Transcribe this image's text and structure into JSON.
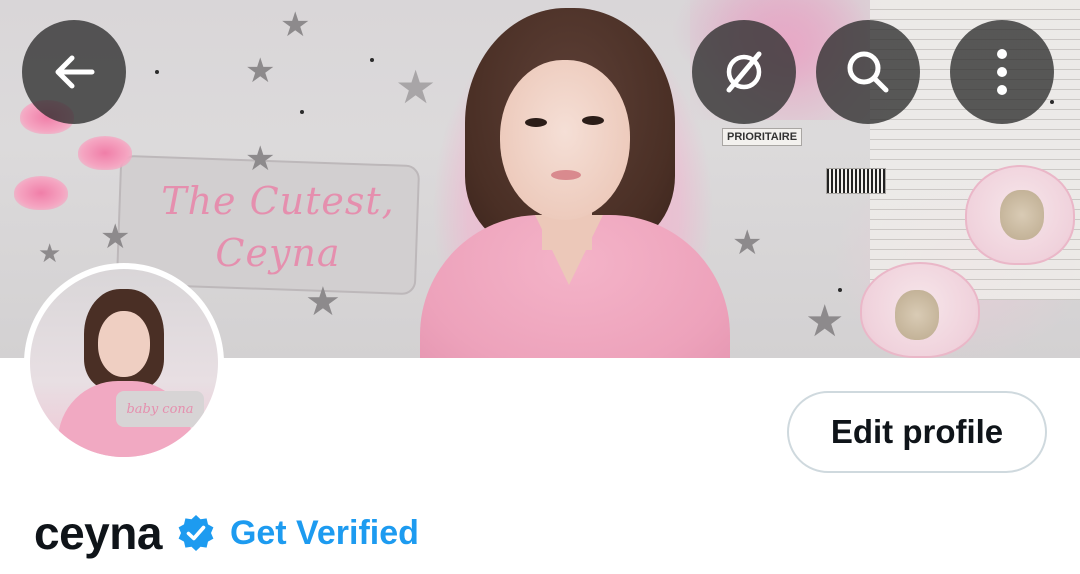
{
  "banner": {
    "script_text_line1": "The Cutest,",
    "script_text_line2": "Ceyna",
    "ticket_text": "PRIORITAIRE"
  },
  "avatar": {
    "tag_text": "baby cona"
  },
  "header_buttons": {
    "back_icon": "arrow-left-icon",
    "grok_icon": "slashed-circle-icon",
    "search_icon": "search-icon",
    "more_icon": "more-vertical-icon"
  },
  "profile": {
    "edit_label": "Edit profile",
    "display_name": "ceyna",
    "get_verified_label": "Get Verified"
  },
  "colors": {
    "accent": "#1d9bf0",
    "text_primary": "#0f1419",
    "button_border": "#cfd9de",
    "overlay_button": "#2d2d2d"
  }
}
